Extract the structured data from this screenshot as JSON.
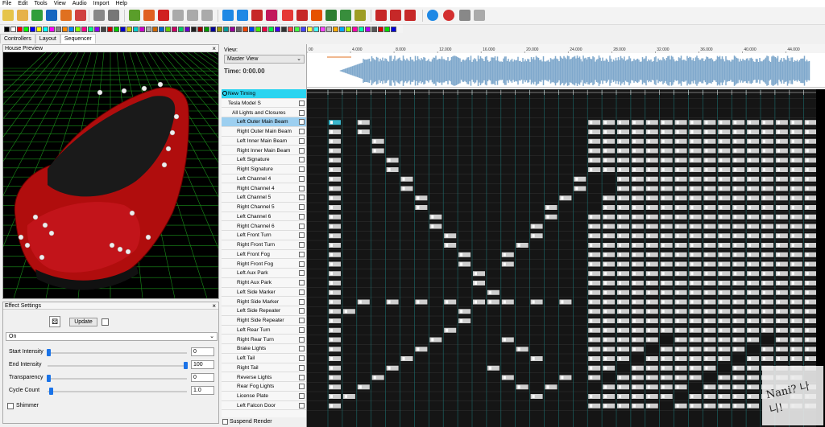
{
  "menu": [
    "File",
    "Edit",
    "Tools",
    "View",
    "Audio",
    "Import",
    "Help"
  ],
  "tabs": [
    "Controllers",
    "Layout",
    "Sequencer"
  ],
  "active_tab": "Sequencer",
  "preview": {
    "title": "House Preview"
  },
  "effect": {
    "title": "Effect Settings",
    "update_label": "Update",
    "effect_type": "On",
    "params": [
      {
        "label": "Start Intensity",
        "value": "0",
        "level": 0
      },
      {
        "label": "End Intensity",
        "value": "100",
        "level": 1
      },
      {
        "label": "Transparency",
        "value": "0",
        "level": 0
      },
      {
        "label": "Cycle Count",
        "value": "1.0",
        "level": 0.02
      }
    ],
    "shimmer_label": "Shimmer"
  },
  "sequencer": {
    "view_label": "View:",
    "view_value": "Master View",
    "time_label": "Time: 0:00.00",
    "ruler_labels": [
      "00",
      "4.000",
      "8.000",
      "12.000",
      "16.000",
      "20.000",
      "24.000",
      "28.000",
      "32.000",
      "36.000",
      "40.000",
      "44.000"
    ],
    "timing_row": "New Timing",
    "tree": [
      {
        "label": "Tesla Model S",
        "indent": 1
      },
      {
        "label": "All Lights and Closures",
        "indent": 2
      },
      {
        "label": "Left Outer Main Beam",
        "indent": 3,
        "selected": true
      },
      {
        "label": "Right Outer Main Beam",
        "indent": 3
      },
      {
        "label": "Left Inner Main Beam",
        "indent": 3
      },
      {
        "label": "Right Inner Main Beam",
        "indent": 3
      },
      {
        "label": "Left Signature",
        "indent": 3
      },
      {
        "label": "Right Signature",
        "indent": 3
      },
      {
        "label": "Left Channel 4",
        "indent": 3
      },
      {
        "label": "Right Channel 4",
        "indent": 3
      },
      {
        "label": "Left Channel 5",
        "indent": 3
      },
      {
        "label": "Right Channel 5",
        "indent": 3
      },
      {
        "label": "Left Channel 6",
        "indent": 3
      },
      {
        "label": "Right Channel 6",
        "indent": 3
      },
      {
        "label": "Left Front Turn",
        "indent": 3
      },
      {
        "label": "Right Front Turn",
        "indent": 3
      },
      {
        "label": "Left Front Fog",
        "indent": 3
      },
      {
        "label": "Right Front Fog",
        "indent": 3
      },
      {
        "label": "Left Aux Park",
        "indent": 3
      },
      {
        "label": "Right Aux Park",
        "indent": 3
      },
      {
        "label": "Left Side Marker",
        "indent": 3
      },
      {
        "label": "Right Side Marker",
        "indent": 3
      },
      {
        "label": "Left Side Repeater",
        "indent": 3
      },
      {
        "label": "Right Side Repeater",
        "indent": 3
      },
      {
        "label": "Left Rear Turn",
        "indent": 3
      },
      {
        "label": "Right Rear Turn",
        "indent": 3
      },
      {
        "label": "Brake Lights",
        "indent": 3
      },
      {
        "label": "Left Tail",
        "indent": 3
      },
      {
        "label": "Right Tail",
        "indent": 3
      },
      {
        "label": "Reverse Lights",
        "indent": 3
      },
      {
        "label": "Rear Fog Lights",
        "indent": 3
      },
      {
        "label": "License Plate",
        "indent": 3
      },
      {
        "label": "Left Falcon Door",
        "indent": 3
      }
    ],
    "suspend_render_label": "Suspend Render"
  },
  "watermark": "Nani? 나니!"
}
